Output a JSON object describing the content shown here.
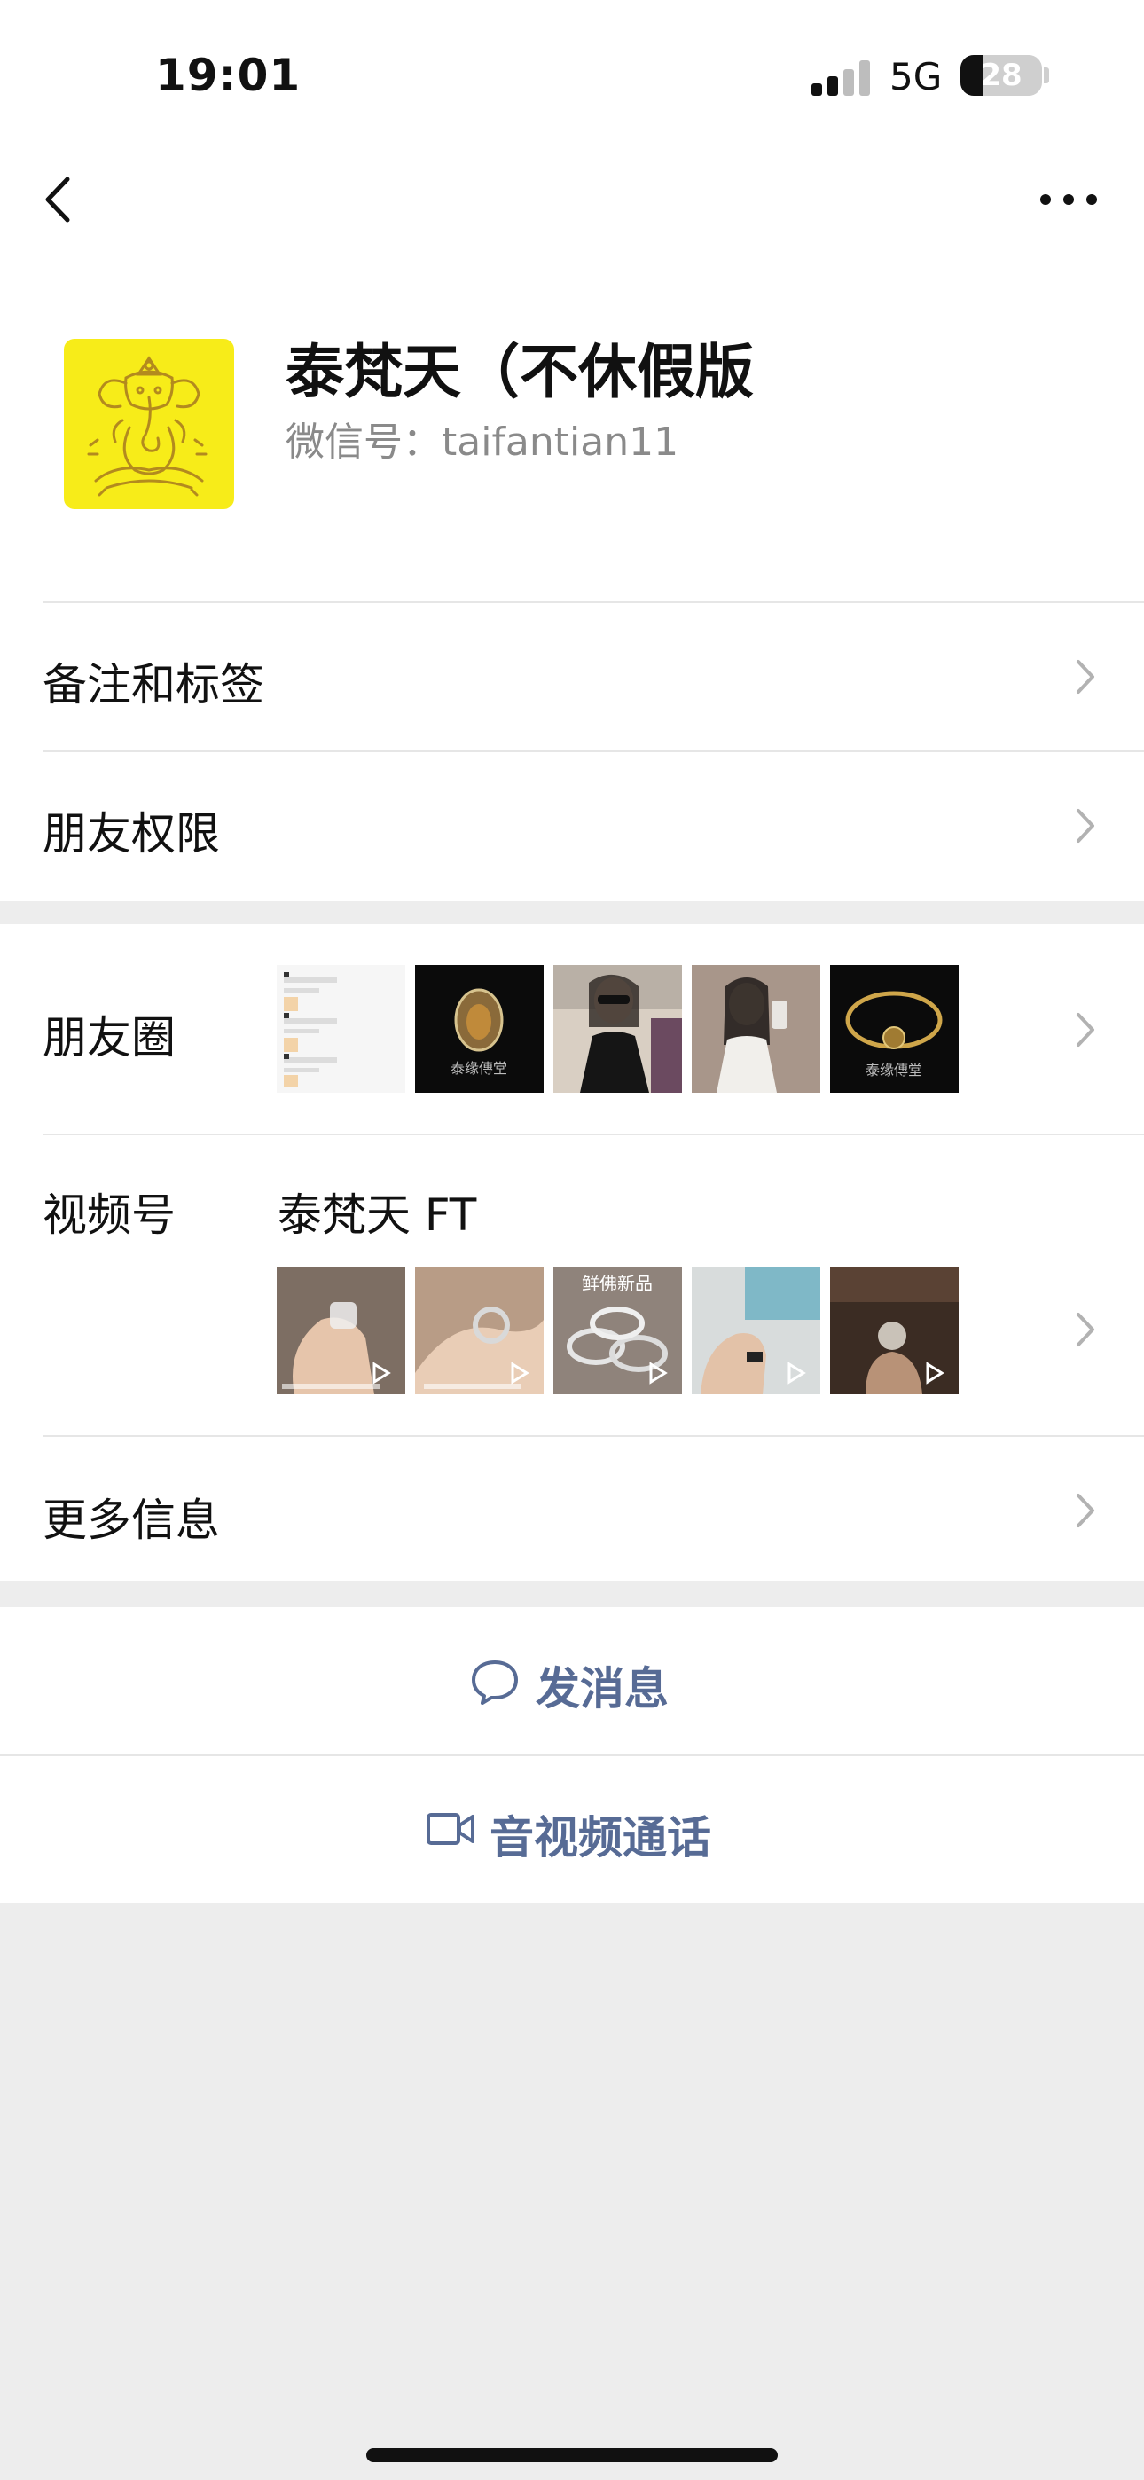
{
  "status_bar": {
    "time": "19:01",
    "network": "5G",
    "battery_level": "28",
    "battery_fraction": 0.28
  },
  "nav": {
    "back_icon": "chevron-left-icon",
    "more_icon": "more-dots-icon"
  },
  "profile": {
    "avatar_icon": "deity-avatar-icon",
    "name": "泰梵天（不休假版",
    "wechat_id": "微信号：taifantian11"
  },
  "rows": {
    "remark": "备注和标签",
    "permissions": "朋友权限",
    "moments": "朋友圈",
    "channels": "视频号",
    "channels_name": "泰梵天 FT",
    "more_info": "更多信息"
  },
  "moments_thumbs": [
    {
      "kind": "chat-screenshot",
      "label": ""
    },
    {
      "kind": "amulet-black",
      "label": "泰缘傳堂"
    },
    {
      "kind": "person-photo",
      "label": ""
    },
    {
      "kind": "person-selfie",
      "label": ""
    },
    {
      "kind": "bracelet-black",
      "label": "泰缘傳堂"
    }
  ],
  "channels_thumbs": [
    {
      "kind": "video",
      "label": ""
    },
    {
      "kind": "video",
      "label": ""
    },
    {
      "kind": "video",
      "label": "鲜佛新品"
    },
    {
      "kind": "video",
      "label": ""
    },
    {
      "kind": "video",
      "label": ""
    }
  ],
  "actions": {
    "message": "发消息",
    "message_icon": "chat-bubble-icon",
    "call": "音视频通话",
    "call_icon": "video-camera-icon"
  },
  "colors": {
    "link": "#576b95",
    "avatar_bg": "#f7ec19",
    "page_bg": "#ededed"
  }
}
